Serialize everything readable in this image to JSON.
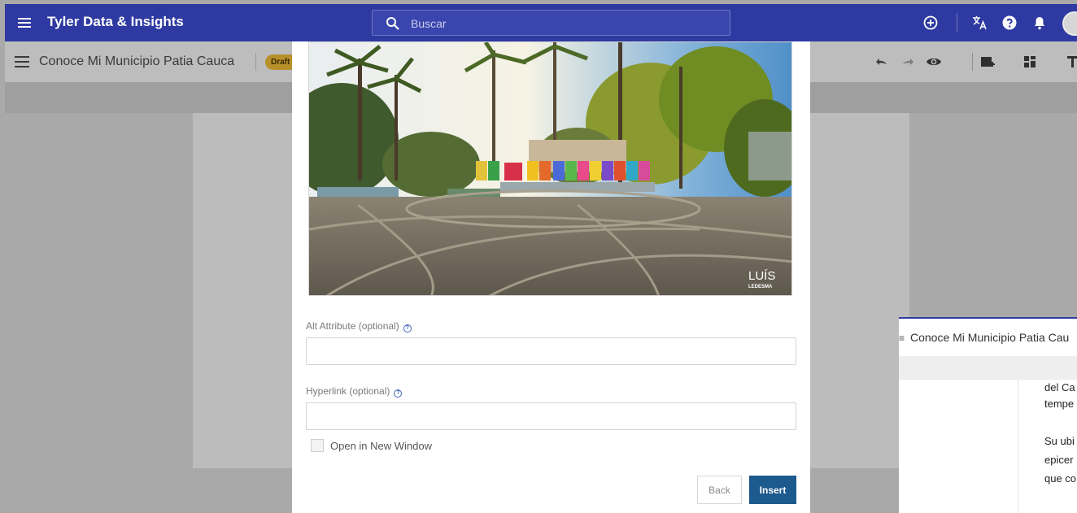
{
  "app": {
    "brand": "Tyler Data & Insights",
    "search_placeholder": "Buscar"
  },
  "editor": {
    "title": "Conoce Mi Municipio Patia Cauca",
    "badge": "Draft"
  },
  "modal": {
    "image": {
      "letters": "YO ♥ EL BORDO",
      "watermark_line1": "LUÍS",
      "watermark_line2": "LEDESMA"
    },
    "alt_label": "Alt Attribute (optional)",
    "alt_value": "",
    "hyperlink_label": "Hyperlink (optional)",
    "hyperlink_value": "",
    "open_new_window_label": "Open in New Window",
    "back_label": "Back",
    "insert_label": "Insert"
  },
  "preview": {
    "title": "Conoce Mi Municipio Patia Cau",
    "lines": [
      "del Ca",
      "tempe",
      "Su ubi",
      "epicer",
      "que co"
    ]
  },
  "colors": {
    "topbar": "#2e3aa1",
    "insert_button": "#1d5a8e",
    "draft_badge": "#b8902a"
  },
  "icons": [
    "menu-icon",
    "search-icon",
    "add-circle-icon",
    "translate-icon",
    "help-icon",
    "bell-icon",
    "undo-icon",
    "redo-icon",
    "eye-icon",
    "add-card-icon",
    "layout-icon",
    "format-icon"
  ]
}
